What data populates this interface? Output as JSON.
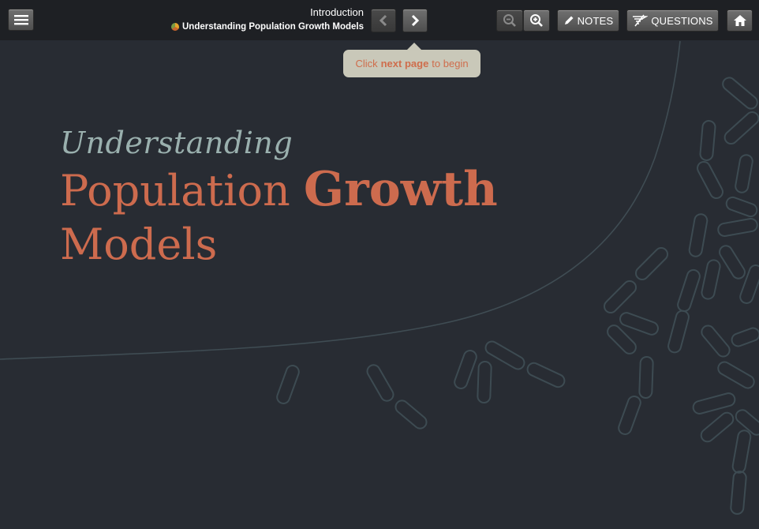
{
  "header": {
    "section_title": "Introduction",
    "course_title": "Understanding Population Growth Models",
    "notes_label": "NOTES",
    "questions_label": "QUESTIONS"
  },
  "icons": {
    "menu": "hamburger-icon",
    "prev": "chevron-left-icon",
    "next": "chevron-right-icon",
    "zoom_out": "zoom-out-icon",
    "zoom_in": "zoom-in-icon",
    "notes": "pencil-icon",
    "questions": "questions-icon",
    "home": "home-icon",
    "course": "course-logo-icon"
  },
  "tooltip": {
    "prefix": "Click",
    "emphasis": "next page",
    "suffix": "to begin"
  },
  "title": {
    "line1": "Understanding",
    "line2a": "Population",
    "line2b": "Growth",
    "line3": "Models"
  },
  "colors": {
    "background": "#282c33",
    "toolbar": "#1e2024",
    "accent": "#cd6b4e",
    "subtitle": "#9ab0ae",
    "tooltip_bg": "#c9c8b9",
    "decoration": "#3d4b52"
  }
}
